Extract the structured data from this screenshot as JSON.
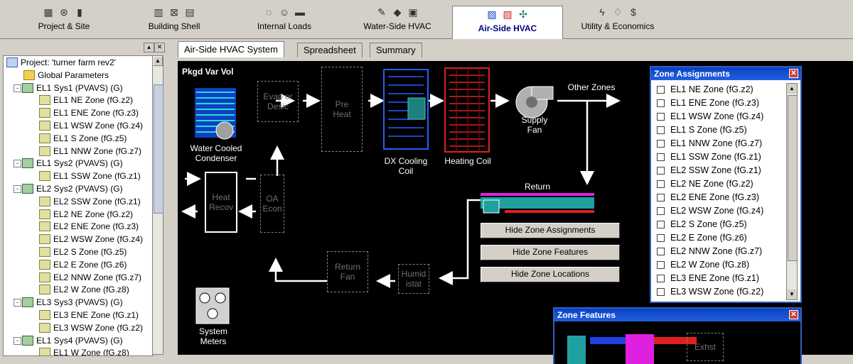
{
  "top_tabs": [
    {
      "label": "Project & Site",
      "icons": [
        "building-icon",
        "satellite-icon",
        "bar-chart-icon"
      ],
      "active": false
    },
    {
      "label": "Building Shell",
      "icons": [
        "wall-icon",
        "window-icon",
        "panel-icon"
      ],
      "active": false
    },
    {
      "label": "Internal Loads",
      "icons": [
        "lightbulb-icon",
        "people-icon",
        "equipment-icon"
      ],
      "active": false
    },
    {
      "label": "Water-Side HVAC",
      "icons": [
        "wrench-icon",
        "pump-icon",
        "boiler-icon"
      ],
      "active": false
    },
    {
      "label": "Air-Side HVAC",
      "icons": [
        "coil-blue-icon",
        "coil-red-icon",
        "fan-icon"
      ],
      "active": true
    },
    {
      "label": "Utility & Economics",
      "icons": [
        "lightning-icon",
        "flame-icon",
        "dollar-icon"
      ],
      "active": false
    }
  ],
  "tree": {
    "nodes": [
      {
        "label": "Project:  'turner farm rev2'",
        "type": "proj",
        "level": 0,
        "expander": ""
      },
      {
        "label": "Global Parameters",
        "type": "folder",
        "level": 1,
        "expander": ""
      },
      {
        "label": "EL1 Sys1 (PVAVS) (G)",
        "type": "sys",
        "level": 1,
        "expander": "-"
      },
      {
        "label": "EL1 NE Zone (fG.z2)",
        "type": "zone",
        "level": 2,
        "expander": ""
      },
      {
        "label": "EL1 ENE Zone (fG.z3)",
        "type": "zone",
        "level": 2,
        "expander": ""
      },
      {
        "label": "EL1 WSW Zone (fG.z4)",
        "type": "zone",
        "level": 2,
        "expander": ""
      },
      {
        "label": "EL1 S Zone (fG.z5)",
        "type": "zone",
        "level": 2,
        "expander": ""
      },
      {
        "label": "EL1 NNW Zone (fG.z7)",
        "type": "zone",
        "level": 2,
        "expander": ""
      },
      {
        "label": "EL1 Sys2 (PVAVS) (G)",
        "type": "sys",
        "level": 1,
        "expander": "-"
      },
      {
        "label": "EL1 SSW Zone (fG.z1)",
        "type": "zone",
        "level": 2,
        "expander": ""
      },
      {
        "label": "EL2 Sys2 (PVAVS) (G)",
        "type": "sys",
        "level": 1,
        "expander": "-"
      },
      {
        "label": "EL2 SSW Zone (fG.z1)",
        "type": "zone",
        "level": 2,
        "expander": ""
      },
      {
        "label": "EL2 NE Zone (fG.z2)",
        "type": "zone",
        "level": 2,
        "expander": ""
      },
      {
        "label": "EL2 ENE Zone (fG.z3)",
        "type": "zone",
        "level": 2,
        "expander": ""
      },
      {
        "label": "EL2 WSW Zone (fG.z4)",
        "type": "zone",
        "level": 2,
        "expander": ""
      },
      {
        "label": "EL2 S Zone (fG.z5)",
        "type": "zone",
        "level": 2,
        "expander": ""
      },
      {
        "label": "EL2 E Zone (fG.z6)",
        "type": "zone",
        "level": 2,
        "expander": ""
      },
      {
        "label": "EL2 NNW Zone (fG.z7)",
        "type": "zone",
        "level": 2,
        "expander": ""
      },
      {
        "label": "EL2 W Zone (fG.z8)",
        "type": "zone",
        "level": 2,
        "expander": ""
      },
      {
        "label": "EL3 Sys3 (PVAVS) (G)",
        "type": "sys",
        "level": 1,
        "expander": "-"
      },
      {
        "label": "EL3 ENE Zone (fG.z1)",
        "type": "zone",
        "level": 2,
        "expander": ""
      },
      {
        "label": "EL3 WSW Zone (fG.z2)",
        "type": "zone",
        "level": 2,
        "expander": ""
      },
      {
        "label": "EL1 Sys4 (PVAVS) (G)",
        "type": "sys",
        "level": 1,
        "expander": "-"
      },
      {
        "label": "EL1 W Zone (fG.z8)",
        "type": "zone",
        "level": 2,
        "expander": ""
      }
    ]
  },
  "sub_tabs": [
    {
      "label": "Air-Side HVAC System",
      "active": true
    },
    {
      "label": "Spreadsheet",
      "active": false
    },
    {
      "label": "Summary",
      "active": false
    }
  ],
  "diagram": {
    "system_name": "Pkgd Var Vol",
    "condenser_label": "Water Cooled\nCondenser",
    "evap_label": "Evap or\nDesic",
    "preheat_label": "Pre\nHeat",
    "dx_label": "DX Cooling\nCoil",
    "heating_label": "Heating Coil",
    "supply_fan_label": "Supply\nFan",
    "other_zones_label": "Other Zones",
    "return_label": "Return",
    "heat_recov_label": "Heat\nRecov",
    "oa_econ_label": "OA\nEcon",
    "return_fan_label": "Return\nFan",
    "humidistat_label": "Humid\nistat",
    "system_meters_label": "System\nMeters",
    "buttons": {
      "hide_zone_assignments": "Hide Zone Assignments",
      "hide_zone_features": "Hide Zone Features",
      "hide_zone_locations": "Hide Zone Locations"
    }
  },
  "zone_assignments": {
    "title": "Zone Assignments",
    "items": [
      "EL1 NE Zone (fG.z2)",
      "EL1 ENE Zone (fG.z3)",
      "EL1 WSW Zone (fG.z4)",
      "EL1 S Zone (fG.z5)",
      "EL1 NNW Zone (fG.z7)",
      "EL1 SSW Zone (fG.z1)",
      "EL2 SSW Zone (fG.z1)",
      "EL2 NE Zone (fG.z2)",
      "EL2 ENE Zone (fG.z3)",
      "EL2 WSW Zone (fG.z4)",
      "EL2 S Zone (fG.z5)",
      "EL2 E Zone (fG.z6)",
      "EL2 NNW Zone (fG.z7)",
      "EL2 W Zone (fG.z8)",
      "EL3 ENE Zone (fG.z1)",
      "EL3 WSW Zone (fG.z2)"
    ]
  },
  "zone_features": {
    "title": "Zone Features",
    "exhaust_label": "Exhst"
  }
}
